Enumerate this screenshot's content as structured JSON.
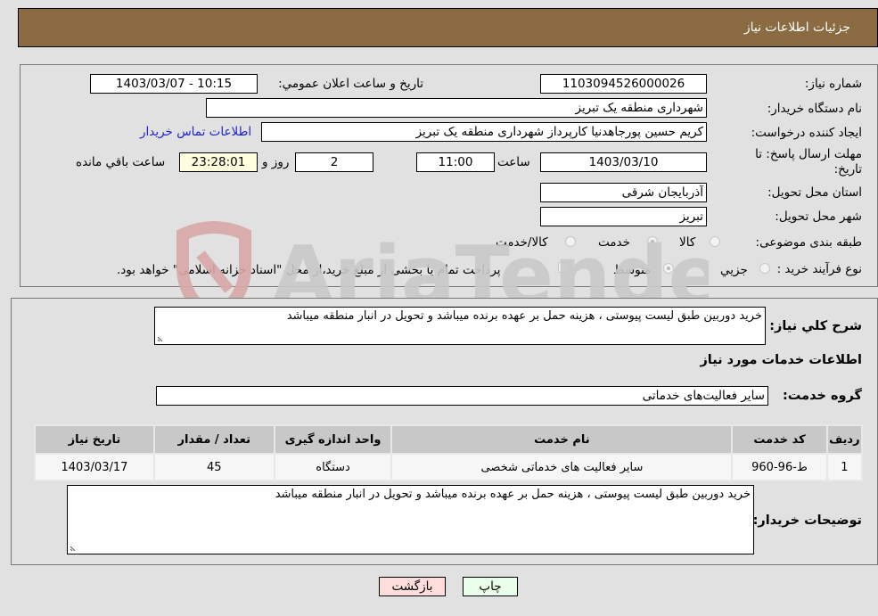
{
  "header": {
    "title": "جزئیات اطلاعات نیاز"
  },
  "details": {
    "need_number_label": "شماره نیاز:",
    "need_number": "1103094526000026",
    "announce_label": "تاریخ و ساعت اعلان عمومي:",
    "announce_value": "1403/03/07 - 10:15",
    "buyer_org_label": "نام دستگاه خریدار:",
    "buyer_org": "شهرداری منطقه یک تبریز",
    "creator_label": "ایجاد کننده درخواست:",
    "creator": "کریم حسین پورجاهدنیا کارپرداز شهرداری منطقه یک تبریز",
    "contact_link": "اطلاعات تماس خریدار",
    "deadline_label": "مهلت ارسال پاسخ: تا تاریخ:",
    "deadline_date": "1403/03/10",
    "time_label": "ساعت",
    "deadline_time": "11:00",
    "days_value": "2",
    "days_label": "روز و",
    "remaining_time": "23:28:01",
    "remaining_label": "ساعت باقي مانده",
    "province_label": "استان محل تحویل:",
    "province": "آذربایجان شرقی",
    "city_label": "شهر محل تحویل:",
    "city": "تبریز",
    "category_label": "طبقه بندی موضوعی:",
    "category_options": [
      {
        "label": "کالا",
        "selected": false
      },
      {
        "label": "خدمت",
        "selected": true
      },
      {
        "label": "کالا/خدمت",
        "selected": false
      }
    ],
    "process_label": "نوع فرآیند خرید :",
    "process_options": [
      {
        "label": "جزيي",
        "selected": false
      },
      {
        "label": "متوسط",
        "selected": true
      }
    ],
    "treasury_checkbox_label": "پرداخت تمام یا بخشی از مبلغ خرید،از محل \"اسناد خزانه اسلامی\" خواهد بود.",
    "treasury_checked": false
  },
  "needs": {
    "summary_label": "شرح كلي نياز:",
    "summary": "خرید دوربین طبق لیست پیوستی ، هزینه حمل بر عهده برنده میباشد و تحویل در انبار منطقه میباشد",
    "services_heading": "اطلاعات خدمات مورد نیاز",
    "service_group_label": "گروه خدمت:",
    "service_group": "سایر فعالیت‌های خدماتی",
    "table": {
      "headers": [
        "ردیف",
        "کد خدمت",
        "نام خدمت",
        "واحد اندازه گیری",
        "تعداد / مقدار",
        "تاریخ نیاز"
      ],
      "rows": [
        [
          "1",
          "ط-96-960",
          "سایر فعالیت های خدماتی شخصی",
          "دستگاه",
          "45",
          "1403/03/17"
        ]
      ]
    },
    "buyer_notes_label": "توضیحات خریدار:",
    "buyer_notes": "خرید دوربین طبق لیست پیوستی ، هزینه حمل بر عهده برنده میباشد و تحویل در انبار منطقه میباشد"
  },
  "buttons": {
    "print": "چاپ",
    "back": "بازگشت"
  },
  "watermark": {
    "text": "AriaTender.neT"
  },
  "colors": {
    "header_bg": "#8b6b42",
    "print_bg": "#eaffea",
    "back_bg": "#ffdddd",
    "remaining_bg": "#ffffe0",
    "link": "#2222cc"
  }
}
